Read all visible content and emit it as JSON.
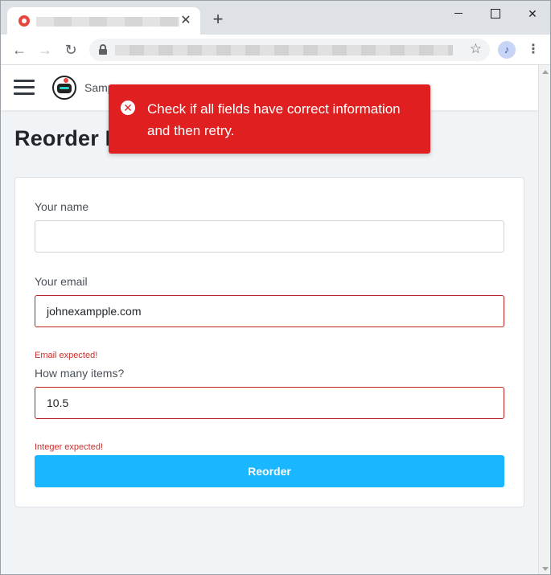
{
  "browser": {
    "close_tab_glyph": "✕",
    "new_tab_glyph": "+",
    "back_glyph": "←",
    "forward_glyph": "→",
    "reload_glyph": "↻",
    "star_glyph": "☆",
    "profile_glyph": "♪",
    "menu_glyph": "⋮"
  },
  "app": {
    "brand": "Samp",
    "page_title": "Reorder I"
  },
  "toast": {
    "icon_glyph": "✕",
    "message": "Check if all fields have correct information and then retry.",
    "color": "#e02020"
  },
  "form": {
    "name": {
      "label": "Your name",
      "value": ""
    },
    "email": {
      "label": "Your email",
      "value": "johnexampple.com",
      "error": "Email expected!"
    },
    "items": {
      "label": "How many items?",
      "value": "10.5",
      "error": "Integer expected!"
    },
    "submit_label": "Reorder",
    "accent": "#1ab6ff",
    "error_color": "#c9302c"
  }
}
